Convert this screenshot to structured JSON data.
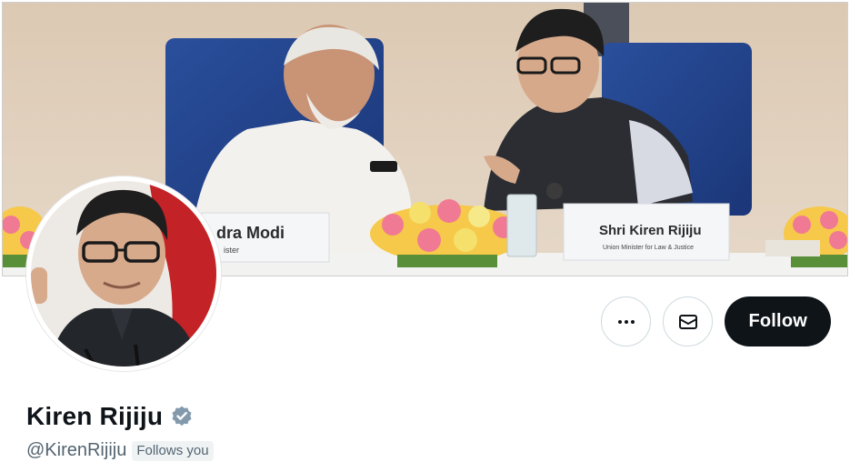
{
  "banner": {
    "nameplate_left": "dra Modi",
    "nameplate_left_sub": "ister",
    "nameplate_right": "Shri Kiren Rijiju",
    "nameplate_right_sub": "Union Minister for Law & Justice"
  },
  "actions": {
    "more_icon": "more-horizontal-icon",
    "message_icon": "envelope-icon",
    "follow_label": "Follow"
  },
  "profile": {
    "display_name": "Kiren Rijiju",
    "verified_icon": "verified-badge-icon",
    "handle": "@KirenRijiju",
    "follows_you": "Follows you"
  },
  "colors": {
    "follow_button_bg": "#0f1419",
    "verified_badge": "#829aab",
    "muted_text": "#536471"
  }
}
